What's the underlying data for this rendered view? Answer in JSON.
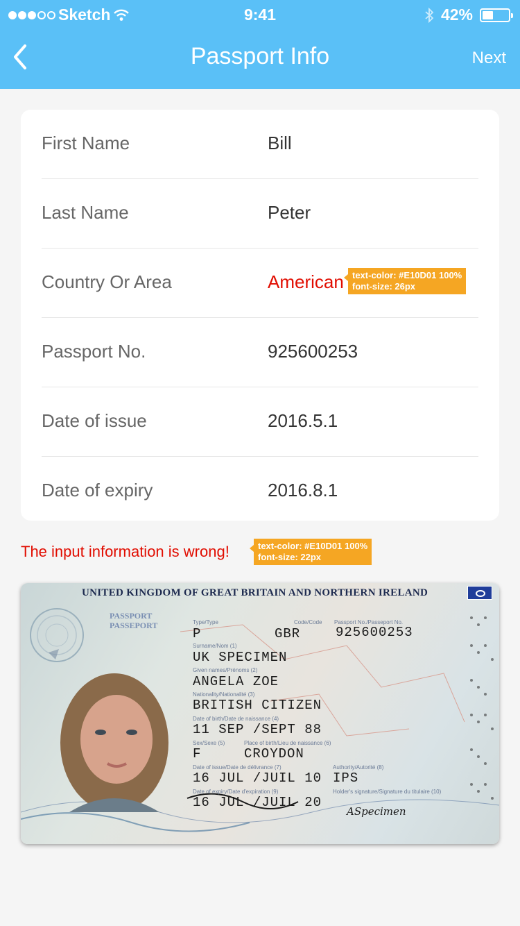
{
  "status_bar": {
    "carrier": "Sketch",
    "time": "9:41",
    "battery": "42%",
    "battery_level": 0.42
  },
  "nav": {
    "title": "Passport Info",
    "next_label": "Next"
  },
  "form": {
    "rows": [
      {
        "label": "First Name",
        "value": "Bill"
      },
      {
        "label": "Last Name",
        "value": "Peter"
      },
      {
        "label": "Country Or Area",
        "value": "American"
      },
      {
        "label": "Passport No.",
        "value": "925600253"
      },
      {
        "label": "Date of issue",
        "value": "2016.5.1"
      },
      {
        "label": "Date of expiry",
        "value": "2016.8.1"
      }
    ]
  },
  "annotations": {
    "country_tip_line1": "text-color: #E10D01 100%",
    "country_tip_line2": "font-size: 26px",
    "error_tip_line1": "text-color: #E10D01 100%",
    "error_tip_line2": "font-size: 22px"
  },
  "error": {
    "message": "The input information is wrong!",
    "color": "#E10D01"
  },
  "passport_image": {
    "header": "UNITED KINGDOM OF GREAT BRITAIN AND NORTHERN IRELAND",
    "word1": "PASSPORT",
    "word2": "PASSEPORT",
    "type": "P",
    "code": "GBR",
    "number": "925600253",
    "surname": "UK SPECIMEN",
    "given_names": "ANGELA ZOE",
    "nationality": "BRITISH CITIZEN",
    "dob": "11 SEP /SEPT 88",
    "sex": "F",
    "place_of_birth": "CROYDON",
    "date_of_issue": "16 JUL /JUIL 10",
    "authority": "IPS",
    "date_of_expiry": "16 JUL /JUIL 20",
    "signature": "ASpecimen",
    "lbl_type": "Type/Type",
    "lbl_code": "Code/Code",
    "lbl_number": "Passport No./Passeport No.",
    "lbl_surname": "Surname/Nom (1)",
    "lbl_given": "Given names/Prénoms (2)",
    "lbl_nationality": "Nationality/Nationalité (3)",
    "lbl_dob": "Date of birth/Date de naissance (4)",
    "lbl_sex": "Sex/Sexe (5)",
    "lbl_pob": "Place of birth/Lieu de naissance (6)",
    "lbl_issue": "Date of issue/Date de délivrance (7)",
    "lbl_authority": "Authority/Autorité (8)",
    "lbl_expiry": "Date of expiry/Date d'expiration (9)",
    "lbl_holder_sig": "Holder's signature/Signature du titulaire (10)"
  },
  "colors": {
    "header_bg": "#5ac0f7",
    "page_bg": "#f5f5f5",
    "tooltip_bg": "#f5a623"
  }
}
